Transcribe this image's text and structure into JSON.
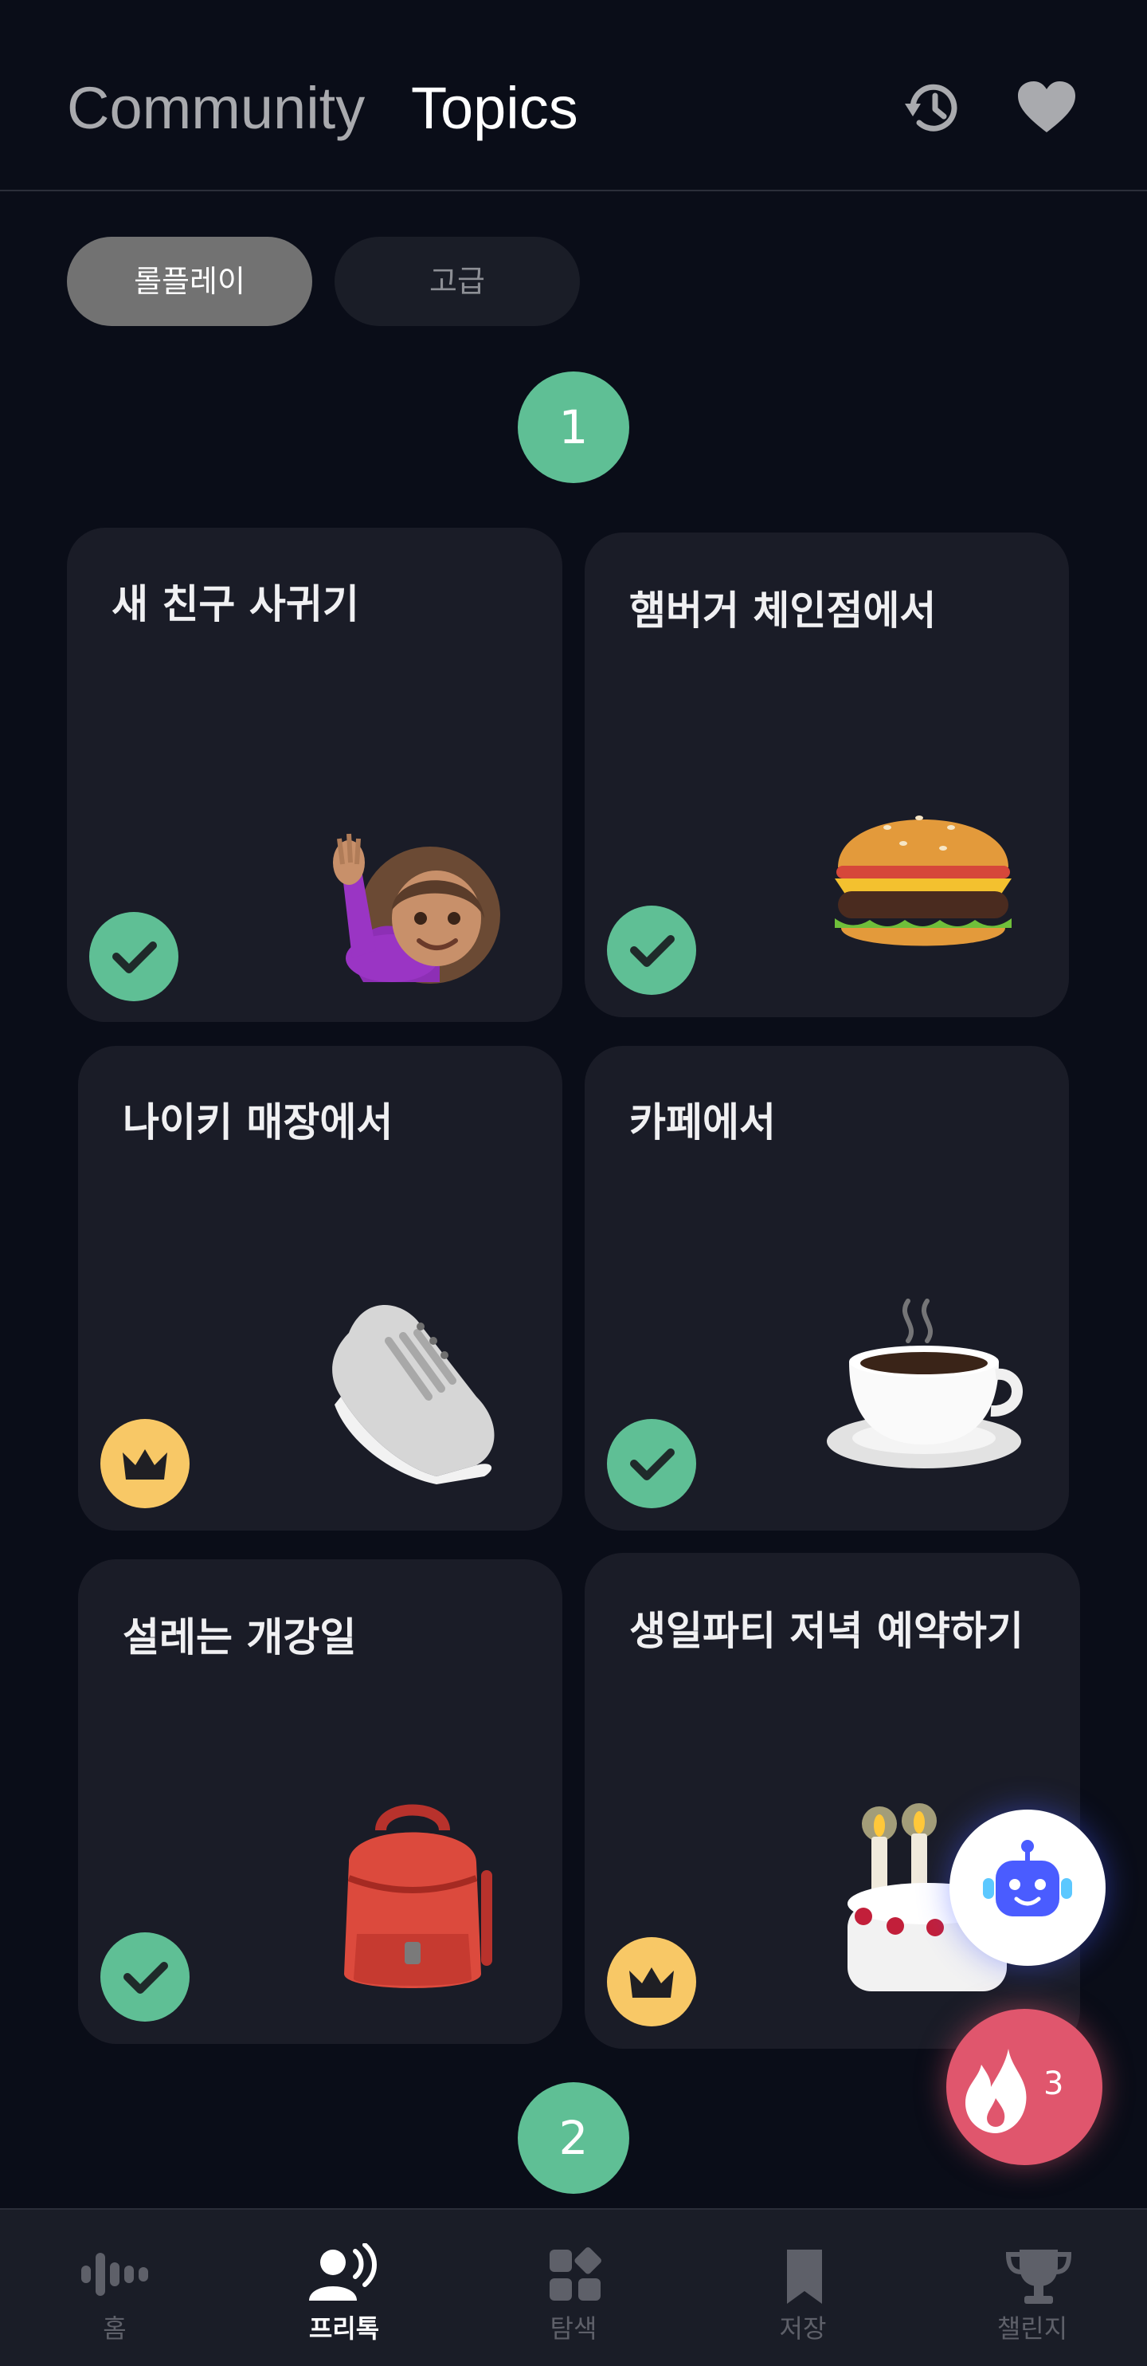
{
  "header": {
    "tabs": [
      {
        "label": "Community",
        "active": false
      },
      {
        "label": "Topics",
        "active": true
      }
    ],
    "icons": [
      "history-icon",
      "heart-icon"
    ]
  },
  "filters": [
    {
      "label": "롤플레이",
      "selected": true
    },
    {
      "label": "고급",
      "selected": false
    }
  ],
  "steps": [
    "1",
    "2"
  ],
  "cards": [
    {
      "title": "새 친구 사귀기",
      "icon": "woman-raising-hand-icon",
      "status": "completed"
    },
    {
      "title": "햄버거 체인점에서",
      "icon": "hamburger-icon",
      "status": "completed"
    },
    {
      "title": "나이키 매장에서",
      "icon": "sneaker-icon",
      "status": "premium"
    },
    {
      "title": "카페에서",
      "icon": "coffee-cup-icon",
      "status": "completed"
    },
    {
      "title": "설레는 개강일",
      "icon": "backpack-icon",
      "status": "completed"
    },
    {
      "title": "생일파티 저녁 예약하기",
      "icon": "birthday-cake-icon",
      "status": "premium"
    }
  ],
  "fab": {
    "bot_icon": "robot-icon",
    "fire_icon": "flame-icon",
    "fire_count": "3"
  },
  "bottom_nav": [
    {
      "label": "홈",
      "icon": "sound-wave-icon",
      "active": false
    },
    {
      "label": "프리톡",
      "icon": "speaking-person-icon",
      "active": true
    },
    {
      "label": "탐색",
      "icon": "grid-explore-icon",
      "active": false
    },
    {
      "label": "저장",
      "icon": "bookmark-icon",
      "active": false
    },
    {
      "label": "챌린지",
      "icon": "trophy-icon",
      "active": false
    }
  ],
  "colors": {
    "background": "#0a0d18",
    "card": "#1a1c27",
    "completed": "#5fbf95",
    "premium": "#f8c866",
    "fire": "#e0566d"
  }
}
